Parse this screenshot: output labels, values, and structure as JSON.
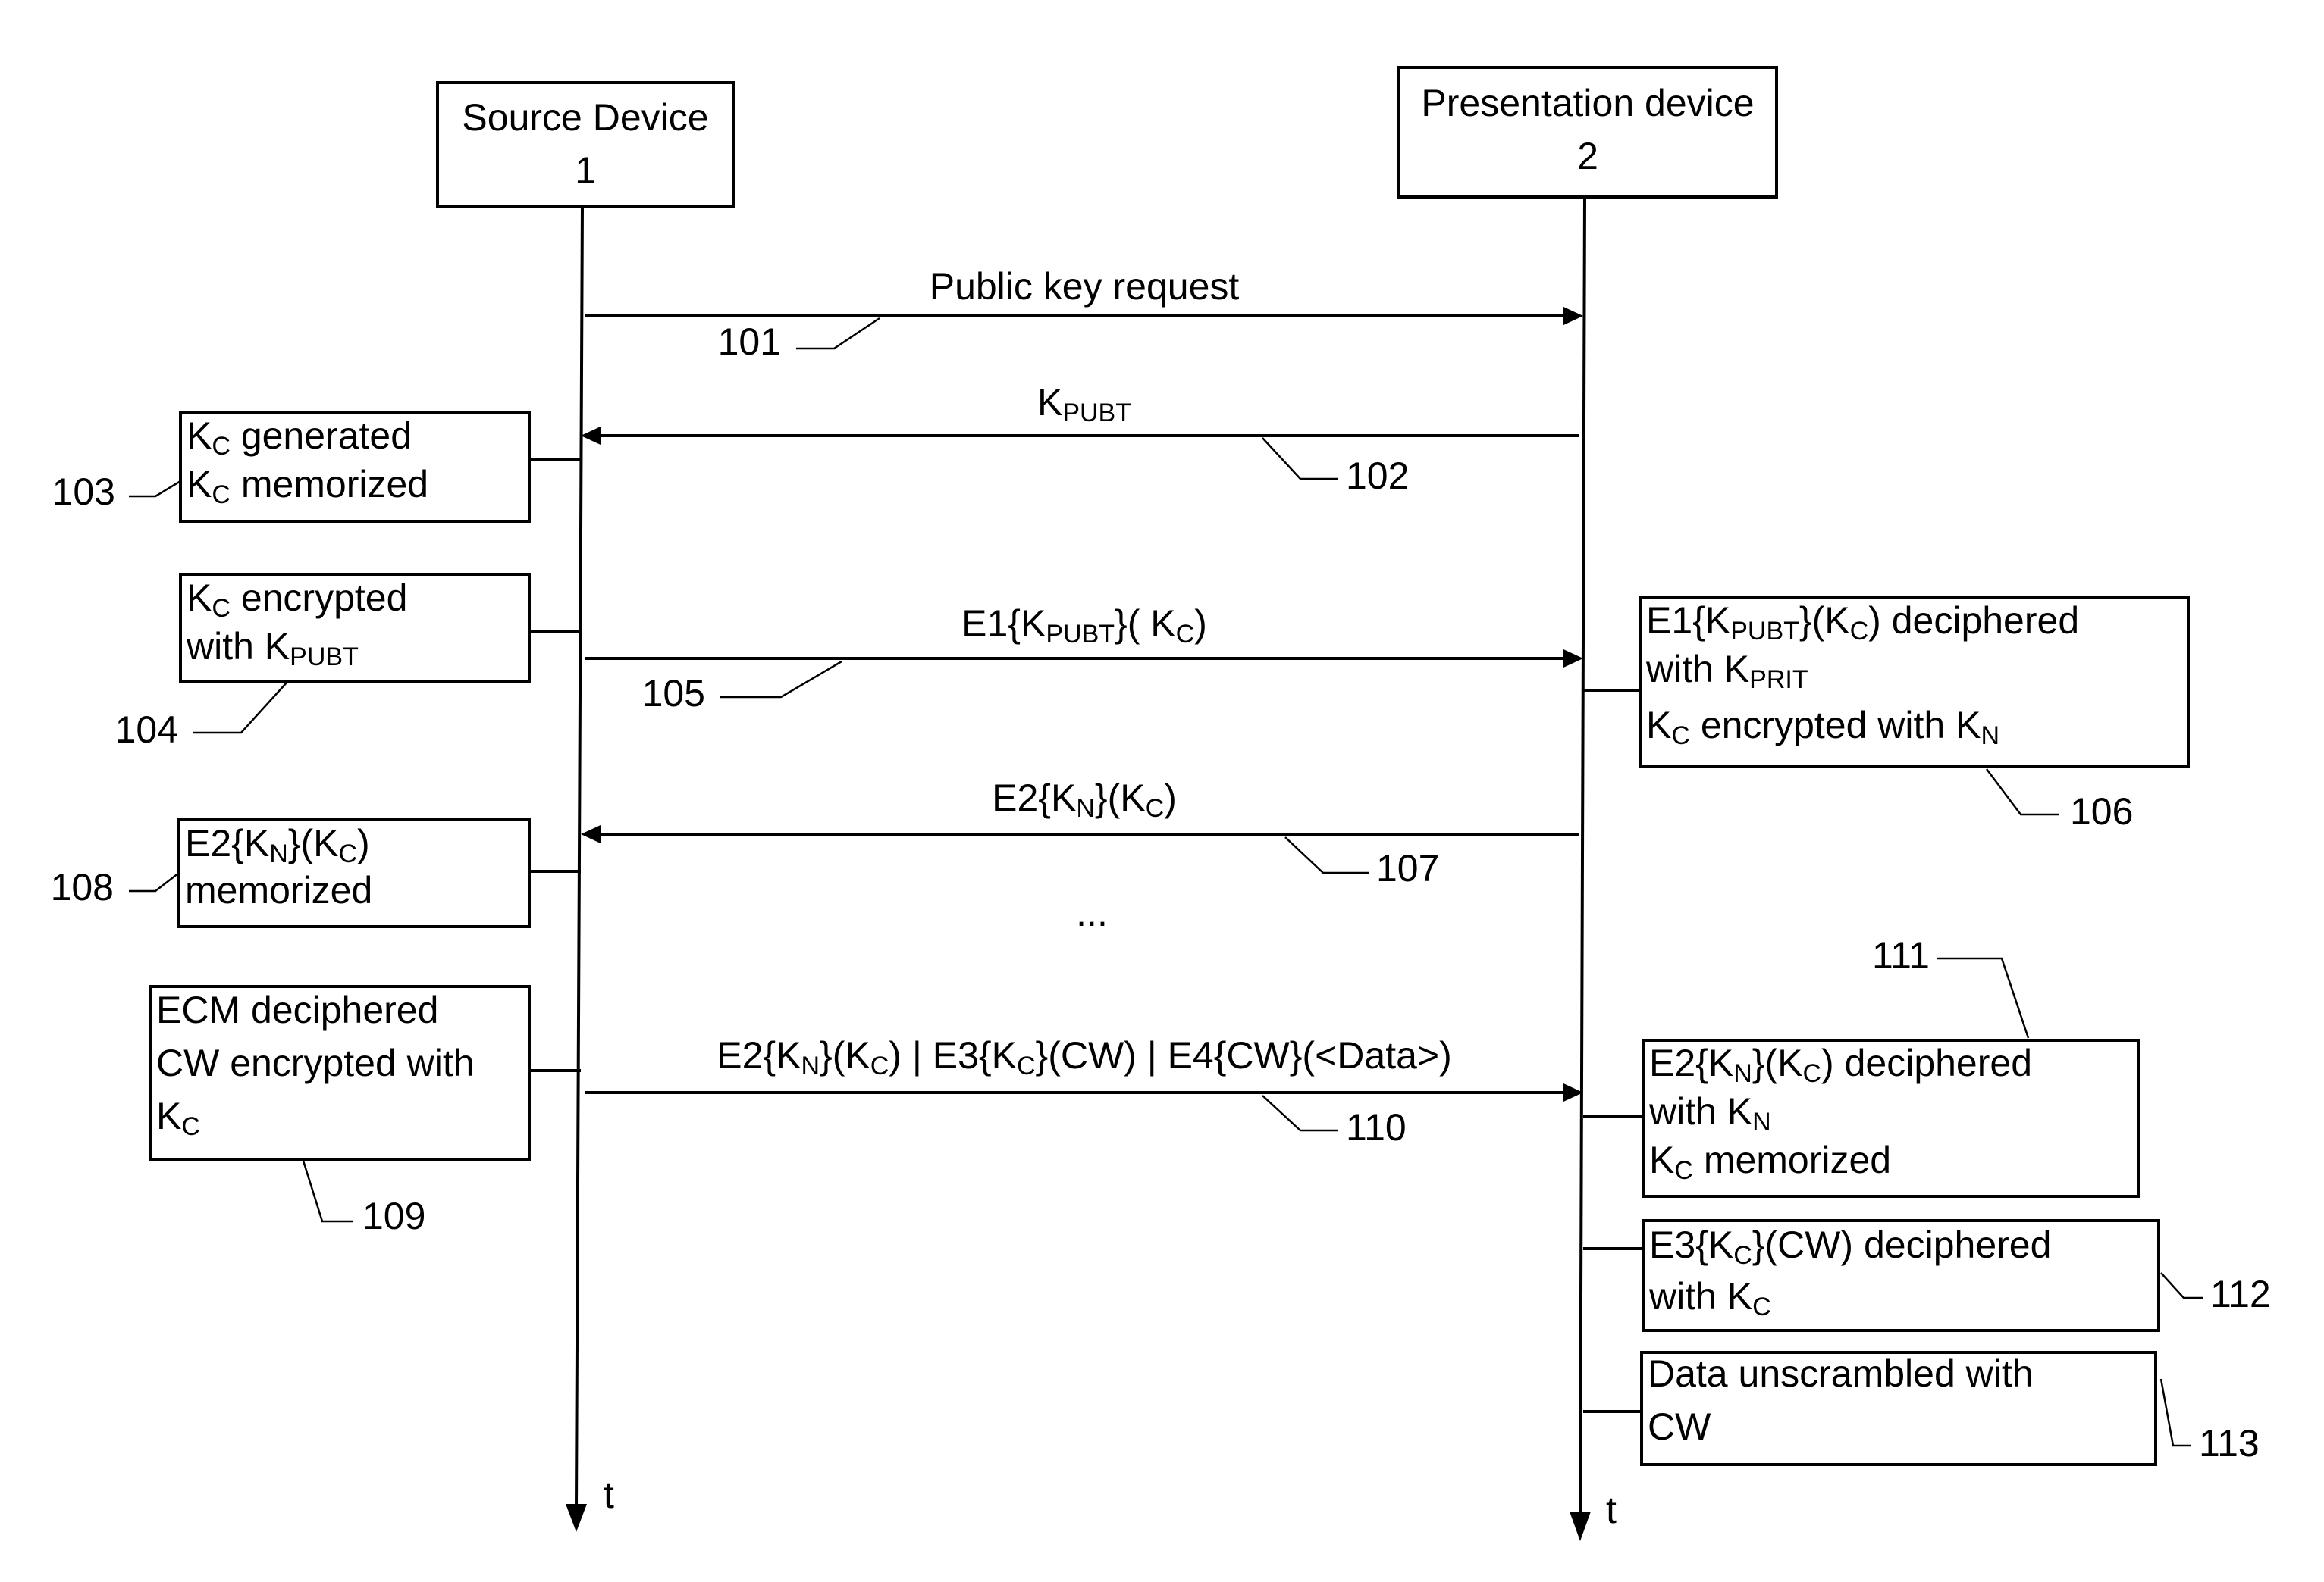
{
  "participants": {
    "source": {
      "name": "Source Device",
      "number": "1"
    },
    "presentation": {
      "name": "Presentation device",
      "number": "2"
    }
  },
  "time_axis_label": "t",
  "messages": [
    {
      "ref": "101",
      "direction": "source-to-presentation",
      "label_parts": [
        [
          "Public key request",
          ""
        ]
      ]
    },
    {
      "ref": "102",
      "direction": "presentation-to-source",
      "label_parts": [
        [
          "K",
          "PUBT"
        ]
      ]
    },
    {
      "ref": "105",
      "direction": "source-to-presentation",
      "label_parts": [
        [
          "E1{K",
          "PUBT"
        ],
        [
          "}( K",
          "C"
        ],
        [
          ")",
          ""
        ]
      ]
    },
    {
      "ref": "107",
      "direction": "presentation-to-source",
      "label_parts": [
        [
          "E2{K",
          "N"
        ],
        [
          "}(K",
          "C"
        ],
        [
          ")",
          ""
        ]
      ]
    },
    {
      "ref": "110",
      "direction": "source-to-presentation",
      "label_parts": [
        [
          "E2{K",
          "N"
        ],
        [
          "}(K",
          "C"
        ],
        [
          ") | E3{K",
          "C"
        ],
        [
          "}(CW) | E4{CW}(<Data>)",
          ""
        ]
      ]
    }
  ],
  "ellipsis": "...",
  "source_steps": [
    {
      "ref": "103",
      "lines": [
        [
          [
            "K",
            "C"
          ],
          [
            " generated",
            ""
          ]
        ],
        [
          [
            "K",
            "C"
          ],
          [
            " memorized",
            ""
          ]
        ]
      ]
    },
    {
      "ref": "104",
      "lines": [
        [
          [
            "K",
            "C"
          ],
          [
            " encrypted",
            ""
          ]
        ],
        [
          [
            "with K",
            "PUBT"
          ]
        ]
      ]
    },
    {
      "ref": "108",
      "lines": [
        [
          [
            "E2{K",
            "N"
          ],
          [
            "}(K",
            "C"
          ],
          [
            ")",
            ""
          ]
        ],
        [
          [
            "memorized",
            ""
          ]
        ]
      ]
    },
    {
      "ref": "109",
      "lines": [
        [
          [
            "ECM deciphered",
            ""
          ]
        ],
        [
          [
            "CW encrypted with",
            ""
          ]
        ],
        [
          [
            "K",
            "C"
          ]
        ]
      ]
    }
  ],
  "presentation_steps": [
    {
      "ref": "106",
      "lines": [
        [
          [
            "E1{K",
            "PUBT"
          ],
          [
            "}(K",
            "C"
          ],
          [
            ") deciphered",
            ""
          ]
        ],
        [
          [
            "with K",
            "PRIT"
          ]
        ],
        [
          [
            "K",
            "C"
          ],
          [
            " encrypted with K",
            "N"
          ]
        ]
      ]
    },
    {
      "ref": "111",
      "lines": [
        [
          [
            "E2{K",
            "N"
          ],
          [
            "}(K",
            "C"
          ],
          [
            ") deciphered",
            ""
          ]
        ],
        [
          [
            "with K",
            "N"
          ]
        ],
        [
          [
            "K",
            "C"
          ],
          [
            " memorized",
            ""
          ]
        ]
      ]
    },
    {
      "ref": "112",
      "lines": [
        [
          [
            "E3{K",
            "C"
          ],
          [
            "}(CW) deciphered",
            ""
          ]
        ],
        [
          [
            "with K",
            "C"
          ]
        ]
      ]
    },
    {
      "ref": "113",
      "lines": [
        [
          [
            "Data unscrambled with",
            ""
          ]
        ],
        [
          [
            "CW",
            ""
          ]
        ]
      ]
    }
  ]
}
